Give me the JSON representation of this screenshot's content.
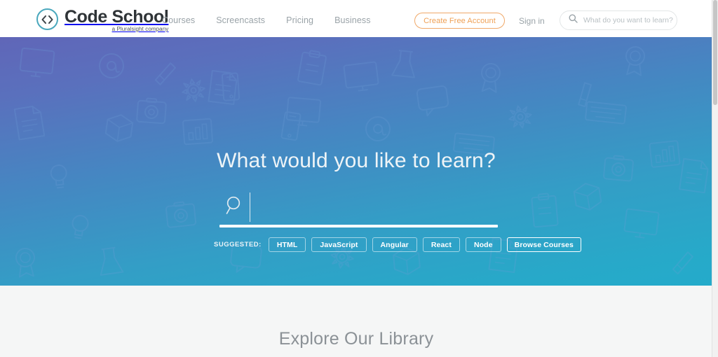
{
  "header": {
    "logo": {
      "icon": "code-brackets-circle-icon",
      "title": "Code School",
      "subtitle": "a Pluralsight company"
    },
    "nav": [
      {
        "label": "Courses"
      },
      {
        "label": "Screencasts"
      },
      {
        "label": "Pricing"
      },
      {
        "label": "Business"
      }
    ],
    "cta_label": "Create Free Account",
    "signin_label": "Sign in",
    "search": {
      "icon": "search-icon",
      "value": "",
      "placeholder": "What do you want to learn?"
    }
  },
  "hero": {
    "title": "What would you like to learn?",
    "search": {
      "icon": "search-icon",
      "value": "",
      "placeholder": ""
    },
    "suggested_label": "SUGGESTED:",
    "tags": [
      {
        "label": "HTML"
      },
      {
        "label": "JavaScript"
      },
      {
        "label": "Angular"
      },
      {
        "label": "React"
      },
      {
        "label": "Node"
      }
    ],
    "browse_label": "Browse Courses"
  },
  "library": {
    "title": "Explore Our Library"
  },
  "colors": {
    "brand_teal": "#4aa8bd",
    "cta_orange": "#efa055",
    "hero_gradient_start": "#6066b8",
    "hero_gradient_end": "#24abca",
    "nav_gray": "#9aa3a8",
    "library_text": "#8b9196"
  }
}
